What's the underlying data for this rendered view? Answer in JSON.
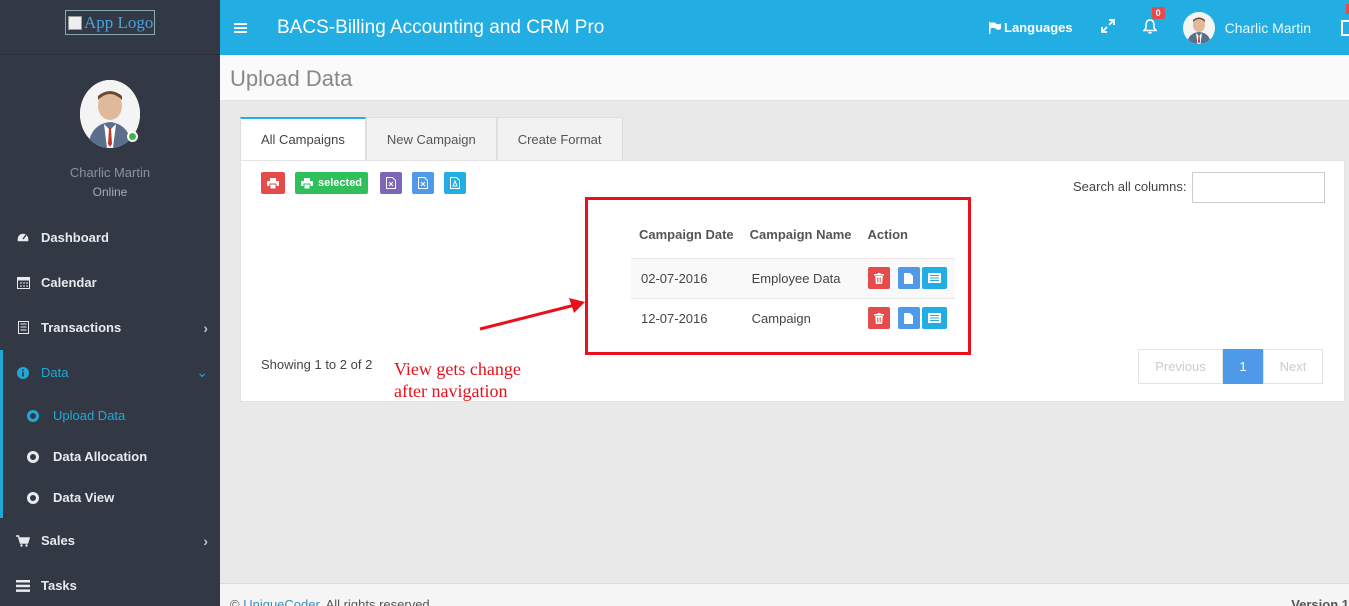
{
  "app": {
    "logo_alt": "App Logo",
    "title": "BACS-Billing Accounting and CRM Pro"
  },
  "header": {
    "languages_label": "Languages",
    "notification_count": "0",
    "user_name": "Charlic Martin"
  },
  "sidebar": {
    "profile_name": "Charlic Martin",
    "profile_status": "Online",
    "items": [
      {
        "label": "Dashboard",
        "icon": "dashboard-icon"
      },
      {
        "label": "Calendar",
        "icon": "calendar-icon"
      },
      {
        "label": "Transactions",
        "icon": "receipt-icon"
      },
      {
        "label": "Data",
        "icon": "info-icon"
      },
      {
        "label": "Sales",
        "icon": "cart-icon"
      },
      {
        "label": "Tasks",
        "icon": "tasks-icon"
      }
    ],
    "data_sub": [
      {
        "label": "Upload Data"
      },
      {
        "label": "Data Allocation"
      },
      {
        "label": "Data View"
      }
    ]
  },
  "page": {
    "title": "Upload Data"
  },
  "tabs": [
    {
      "label": "All Campaigns"
    },
    {
      "label": "New Campaign"
    },
    {
      "label": "Create Format"
    }
  ],
  "toolbar": {
    "selected_label": "selected",
    "search_label": "Search all columns:",
    "search_value": ""
  },
  "table": {
    "headers": [
      "Campaign Date",
      "Campaign Name",
      "Action"
    ],
    "rows": [
      {
        "date": "02-07-2016",
        "name": "Employee Data"
      },
      {
        "date": "12-07-2016",
        "name": "Campaign"
      }
    ]
  },
  "pagination": {
    "showing": "Showing 1 to 2 of 2",
    "previous": "Previous",
    "current": "1",
    "next": "Next"
  },
  "annotation": {
    "line1": "View gets change",
    "line2": "after navigation"
  },
  "footer": {
    "copyright": "©",
    "brand": "UniqueCoder",
    "rights": ". All rights reserved.",
    "version": "Version 1"
  },
  "colors": {
    "header": "#22aee2",
    "sidebar": "#323844",
    "accent": "#21a8d4",
    "danger": "#e54b4b",
    "success": "#2fbf5b",
    "annotation": "#e8101a"
  }
}
